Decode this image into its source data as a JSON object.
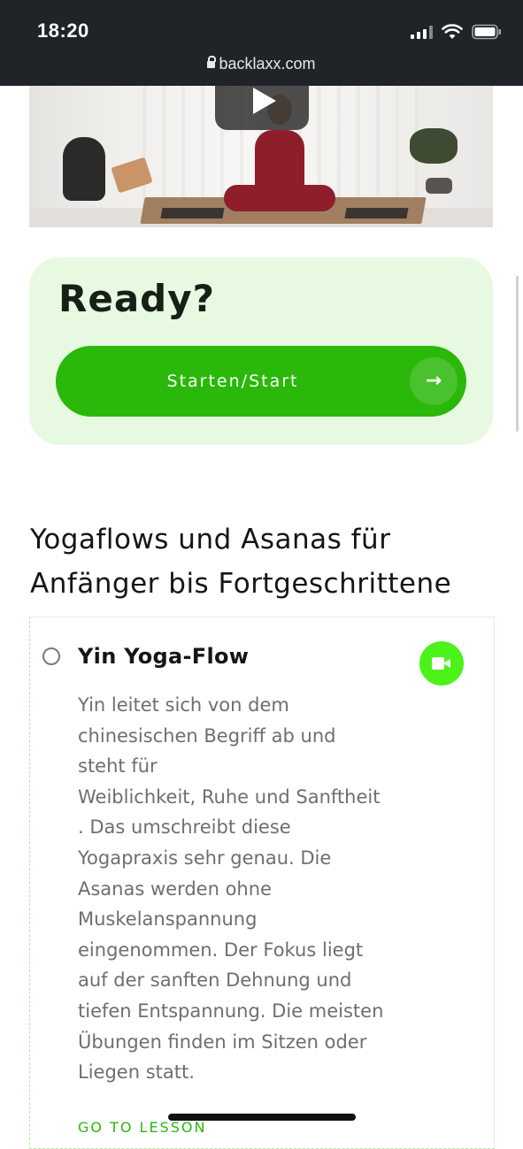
{
  "status_bar": {
    "time": "18:20",
    "url": "backlaxx.com"
  },
  "video": {
    "play_icon": "play-icon"
  },
  "ready": {
    "title": "Ready?",
    "start_label": "Starten/Start",
    "arrow": "→"
  },
  "section": {
    "title": "Yogaflows und Asanas für Anfänger bis Fortgeschrittene"
  },
  "lesson": {
    "title": "Yin Yoga-Flow",
    "description_lines": [
      "Yin leitet sich von dem",
      "chinesischen Begriff ab und",
      "steht für",
      "Weiblichkeit, Ruhe und Sanftheit",
      ". Das umschreibt diese",
      "Yogapraxis sehr genau. Die",
      "Asanas werden ohne",
      "Muskelanspannung",
      "eingenommen. Der Fokus liegt",
      "auf der sanften Dehnung und",
      "tiefen Entspannung. Die meisten",
      "Übungen finden im Sitzen oder",
      "Liegen statt."
    ],
    "link": "GO TO LESSON"
  },
  "colors": {
    "accent_green": "#2ab80a",
    "icon_green": "#4cf21a",
    "card_bg": "#e8f9e1",
    "status_bar_bg": "#202328"
  }
}
